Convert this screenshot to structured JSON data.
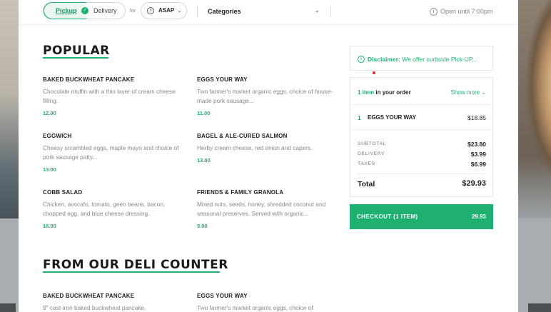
{
  "topbar": {
    "pickup_label": "Pickup",
    "delivery_label": "Delivery",
    "for_label": "for",
    "time_label": "ASAP",
    "categories_label": "Categories",
    "hours_label": "Open until 7:00pm"
  },
  "popular": {
    "title": "POPULAR",
    "items": [
      {
        "name": "BAKED BUCKWHEAT PANCAKE",
        "desc": "Chocolate muffin with a thin layer of cream cheese filling.",
        "price": "12.00"
      },
      {
        "name": "EGGS YOUR WAY",
        "desc": "Two farmer's market organic eggs, choice of house-made pork sausage...",
        "price": "11.00"
      },
      {
        "name": "EGGWICH",
        "desc": "Cheesy scrambled eggs, maple mayo and choice of pork sausage patty...",
        "price": "13.00"
      },
      {
        "name": "BAGEL & ALE-CURED SALMON",
        "desc": "Herby cream cheese, red onion and capers.",
        "price": "13.00"
      },
      {
        "name": "COBB SALAD",
        "desc": "Chicken, avocafo, tomato, geen beans, bacon, chopped egg, and blue cheese dressing.",
        "price": "16.00"
      },
      {
        "name": "FRIENDS & FAMILY GRANOLA",
        "desc": "Mixed nuts, seeds, honey, shredded coconut and seasonal preserves. Served with organic...",
        "price": "9.00"
      }
    ]
  },
  "deli": {
    "title": "FROM OUR DELI COUNTER",
    "items": [
      {
        "name": "BAKED BUCKWHEAT PANCAKE",
        "desc": "9\" cast-iron baked buckwheat pancake."
      },
      {
        "name": "EGGS YOUR WAY",
        "desc": "Two farmer's market organic eggs, choice of"
      }
    ]
  },
  "disclaimer": {
    "label": "Disclaimer:",
    "text": "We offer curbside Pick-UP..."
  },
  "cart": {
    "count_text": "1 item",
    "count_suffix": "in your order",
    "show_more": "Show more",
    "line": {
      "qty": "1",
      "name": "EGGS YOUR WAY",
      "price": "$18.85"
    },
    "subtotal_label": "SUBTOTAL",
    "subtotal": "$23.80",
    "delivery_label": "DELIVERY",
    "delivery": "$3.99",
    "taxes_label": "TAXES",
    "taxes": "$6.99",
    "total_label": "Total",
    "total": "$29.93"
  },
  "checkout": {
    "label": "CHECKOUT (1 ITEM)",
    "amount": "29.93"
  },
  "colors": {
    "accent": "#1db071",
    "notification": "#e0262b"
  }
}
